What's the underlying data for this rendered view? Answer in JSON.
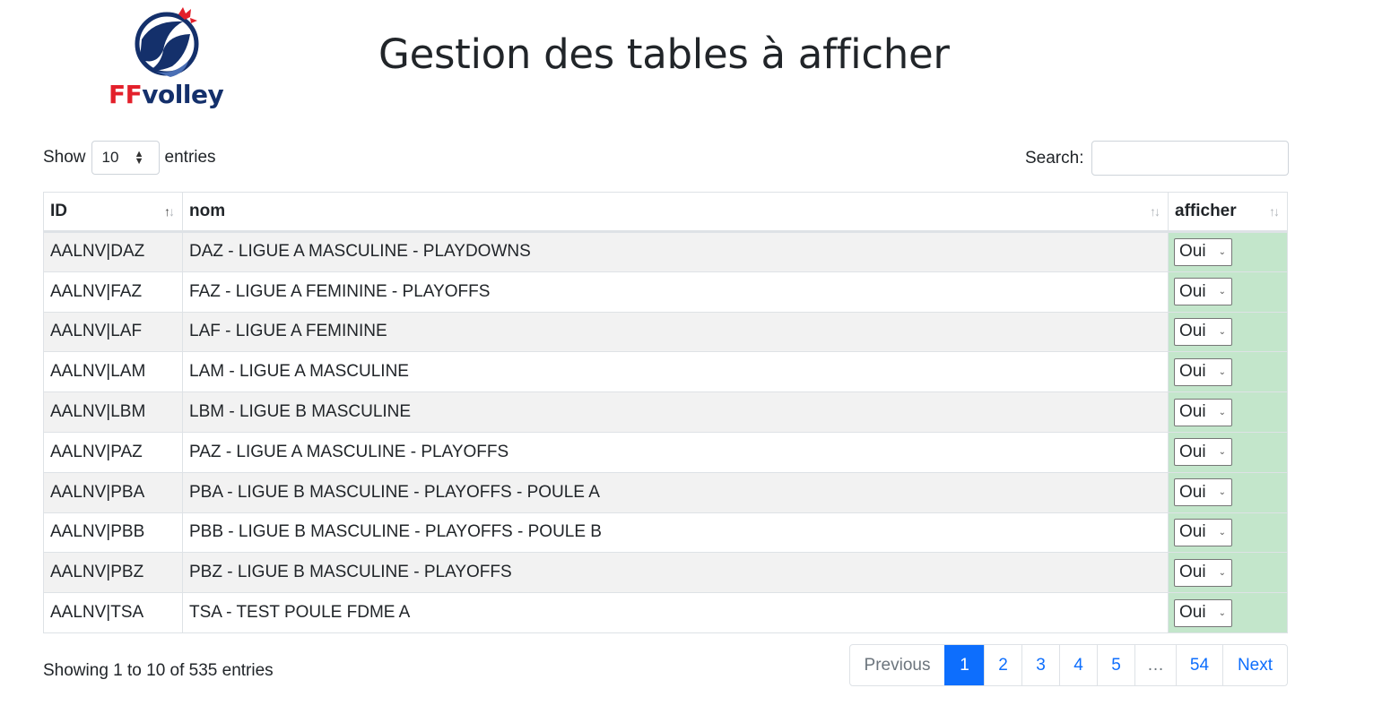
{
  "logo": {
    "ff": "FF",
    "rest": "volley"
  },
  "page_title": "Gestion des tables à afficher",
  "length_control": {
    "show_label": "Show",
    "value": "10",
    "entries_label": "entries"
  },
  "search": {
    "label": "Search:",
    "value": "",
    "placeholder": ""
  },
  "table": {
    "columns": [
      {
        "label": "ID",
        "sort": "asc"
      },
      {
        "label": "nom",
        "sort": "none"
      },
      {
        "label": "afficher",
        "sort": "none"
      }
    ],
    "rows": [
      {
        "id": "AALNV|DAZ",
        "nom": "DAZ - LIGUE A MASCULINE - PLAYDOWNS",
        "afficher": "Oui"
      },
      {
        "id": "AALNV|FAZ",
        "nom": "FAZ - LIGUE A FEMININE - PLAYOFFS",
        "afficher": "Oui"
      },
      {
        "id": "AALNV|LAF",
        "nom": "LAF - LIGUE A FEMININE",
        "afficher": "Oui"
      },
      {
        "id": "AALNV|LAM",
        "nom": "LAM - LIGUE A MASCULINE",
        "afficher": "Oui"
      },
      {
        "id": "AALNV|LBM",
        "nom": "LBM - LIGUE B MASCULINE",
        "afficher": "Oui"
      },
      {
        "id": "AALNV|PAZ",
        "nom": "PAZ - LIGUE A MASCULINE - PLAYOFFS",
        "afficher": "Oui"
      },
      {
        "id": "AALNV|PBA",
        "nom": "PBA - LIGUE B MASCULINE - PLAYOFFS - POULE A",
        "afficher": "Oui"
      },
      {
        "id": "AALNV|PBB",
        "nom": "PBB - LIGUE B MASCULINE - PLAYOFFS - POULE B",
        "afficher": "Oui"
      },
      {
        "id": "AALNV|PBZ",
        "nom": "PBZ - LIGUE B MASCULINE - PLAYOFFS",
        "afficher": "Oui"
      },
      {
        "id": "AALNV|TSA",
        "nom": "TSA - TEST POULE FDME A",
        "afficher": "Oui"
      }
    ]
  },
  "info": "Showing 1 to 10 of 535 entries",
  "pagination": {
    "items": [
      {
        "label": "Previous",
        "state": "disabled"
      },
      {
        "label": "1",
        "state": "active"
      },
      {
        "label": "2",
        "state": ""
      },
      {
        "label": "3",
        "state": ""
      },
      {
        "label": "4",
        "state": ""
      },
      {
        "label": "5",
        "state": ""
      },
      {
        "label": "…",
        "state": "ellipsis"
      },
      {
        "label": "54",
        "state": ""
      },
      {
        "label": "Next",
        "state": ""
      }
    ]
  },
  "colors": {
    "accent": "#0d6efd",
    "afficher_cell": "#c3e6cb",
    "logo_blue": "#14306b",
    "logo_red": "#e3202b"
  }
}
